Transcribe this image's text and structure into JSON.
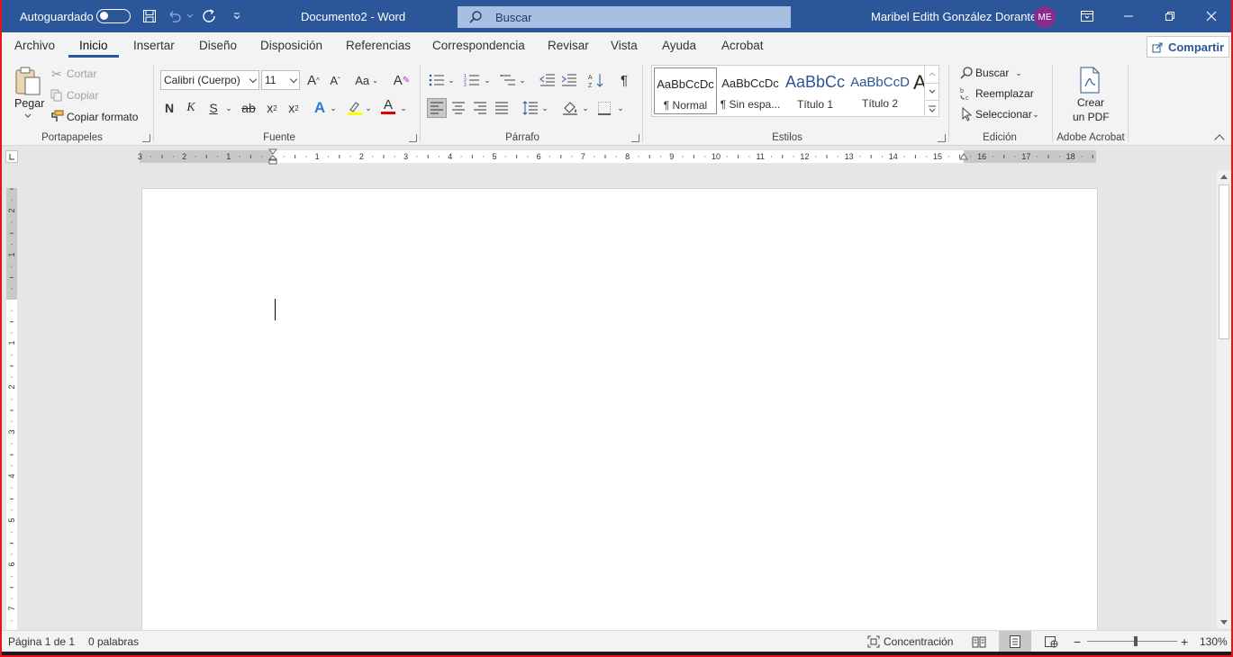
{
  "titlebar": {
    "autosave_label": "Autoguardado",
    "doc_title": "Documento2  -  Word",
    "search_placeholder": "Buscar",
    "user_name": "Maribel Edith González Dorantes",
    "user_initials": "ME",
    "bg_color": "#2b579a"
  },
  "tabs": [
    {
      "label": "Archivo"
    },
    {
      "label": "Inicio"
    },
    {
      "label": "Insertar"
    },
    {
      "label": "Diseño"
    },
    {
      "label": "Disposición"
    },
    {
      "label": "Referencias"
    },
    {
      "label": "Correspondencia"
    },
    {
      "label": "Revisar"
    },
    {
      "label": "Vista"
    },
    {
      "label": "Ayuda"
    },
    {
      "label": "Acrobat"
    }
  ],
  "active_tab": "Inicio",
  "share_label": "Compartir",
  "ribbon": {
    "clipboard": {
      "label": "Portapapeles",
      "paste": "Pegar",
      "cut": "Cortar",
      "copy": "Copiar",
      "format_painter": "Copiar formato"
    },
    "font": {
      "label": "Fuente",
      "font_name": "Calibri (Cuerpo)",
      "font_size": "11"
    },
    "paragraph": {
      "label": "Párrafo"
    },
    "styles": {
      "label": "Estilos",
      "items": [
        {
          "sample": "AaBbCcDc",
          "name": "¶ Normal"
        },
        {
          "sample": "AaBbCcDc",
          "name": "¶ Sin espa..."
        },
        {
          "sample": "AaBbCc",
          "name": "Título 1"
        },
        {
          "sample": "AaBbCcD",
          "name": "Título 2"
        }
      ]
    },
    "editing": {
      "label": "Edición",
      "find": "Buscar",
      "replace": "Reemplazar",
      "select": "Seleccionar"
    },
    "acrobat": {
      "label": "Adobe Acrobat",
      "create_pdf_line1": "Crear",
      "create_pdf_line2": "un PDF"
    }
  },
  "ruler": {
    "labels": [
      "3",
      "2",
      "1",
      "1",
      "2",
      "3",
      "4",
      "5",
      "6",
      "7",
      "8",
      "9",
      "10",
      "11",
      "12",
      "13",
      "14",
      "15",
      "16",
      "17",
      "18"
    ]
  },
  "vruler": {
    "labels": [
      "2",
      "1",
      "1",
      "2",
      "3",
      "4",
      "5",
      "6",
      "7"
    ]
  },
  "statusbar": {
    "page": "Página 1 de 1",
    "words": "0 palabras",
    "focus": "Concentración",
    "zoom": "130%"
  }
}
